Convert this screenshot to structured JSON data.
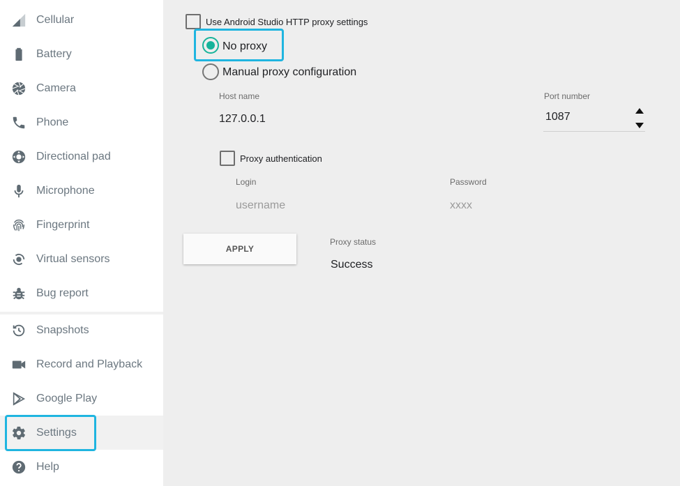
{
  "sidebar": {
    "items": [
      {
        "label": "Cellular",
        "icon": "cellular-signal-icon"
      },
      {
        "label": "Battery",
        "icon": "battery-icon"
      },
      {
        "label": "Camera",
        "icon": "camera-aperture-icon"
      },
      {
        "label": "Phone",
        "icon": "phone-icon"
      },
      {
        "label": "Directional pad",
        "icon": "dpad-icon"
      },
      {
        "label": "Microphone",
        "icon": "microphone-icon"
      },
      {
        "label": "Fingerprint",
        "icon": "fingerprint-icon"
      },
      {
        "label": "Virtual sensors",
        "icon": "virtual-sensors-icon"
      },
      {
        "label": "Bug report",
        "icon": "bug-icon"
      },
      {
        "label": "Snapshots",
        "icon": "history-icon"
      },
      {
        "label": "Record and Playback",
        "icon": "video-camera-icon"
      },
      {
        "label": "Google Play",
        "icon": "google-play-icon"
      },
      {
        "label": "Settings",
        "icon": "gear-icon"
      },
      {
        "label": "Help",
        "icon": "help-icon"
      }
    ],
    "selected": "Settings"
  },
  "proxy": {
    "use_studio_label": "Use Android Studio HTTP proxy settings",
    "use_studio_checked": false,
    "no_proxy_label": "No proxy",
    "manual_label": "Manual proxy configuration",
    "selected_mode": "No proxy",
    "host_caption": "Host name",
    "host_value": "127.0.0.1",
    "port_caption": "Port number",
    "port_value": "1087",
    "auth_label": "Proxy authentication",
    "auth_checked": false,
    "login_caption": "Login",
    "login_placeholder": "username",
    "password_caption": "Password",
    "password_placeholder": "xxxx",
    "apply_label": "APPLY",
    "status_caption": "Proxy status",
    "status_value": "Success"
  },
  "colors": {
    "accent_radio": "#17b39a",
    "highlight": "#1fb5e0",
    "icon_gray": "#5f6b73"
  }
}
